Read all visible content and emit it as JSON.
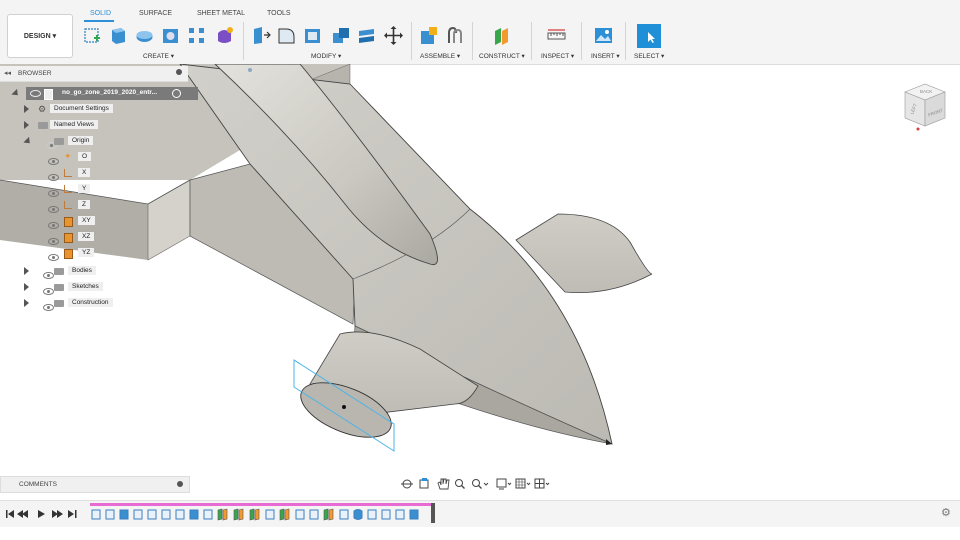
{
  "toolbar": {
    "design_label": "DESIGN ▾",
    "tabs": [
      "SOLID",
      "SURFACE",
      "SHEET METAL",
      "TOOLS"
    ],
    "groups": {
      "create": "CREATE ▾",
      "modify": "MODIFY ▾",
      "assemble": "ASSEMBLE ▾",
      "construct": "CONSTRUCT ▾",
      "inspect": "INSPECT ▾",
      "insert": "INSERT ▾",
      "select": "SELECT ▾"
    }
  },
  "browser": {
    "title": "BROWSER",
    "root": "no_go_zone_2019_2020_entr...",
    "document_settings": "Document Settings",
    "named_views": "Named Views",
    "origin": "Origin",
    "origin_items": [
      "O",
      "X",
      "Y",
      "Z",
      "XY",
      "XZ",
      "YZ"
    ],
    "bodies": "Bodies",
    "sketches": "Sketches",
    "construction": "Construction"
  },
  "comments": {
    "label": "COMMENTS"
  },
  "viewcube": {
    "back": "BACK",
    "left": "LEFT",
    "front": "FRONT"
  },
  "colors": {
    "accent": "#2d8fd6",
    "select_blue": "#1f8fd8",
    "timeline_pink": "#e86bd3",
    "model_gray": "#c8c6c0"
  }
}
